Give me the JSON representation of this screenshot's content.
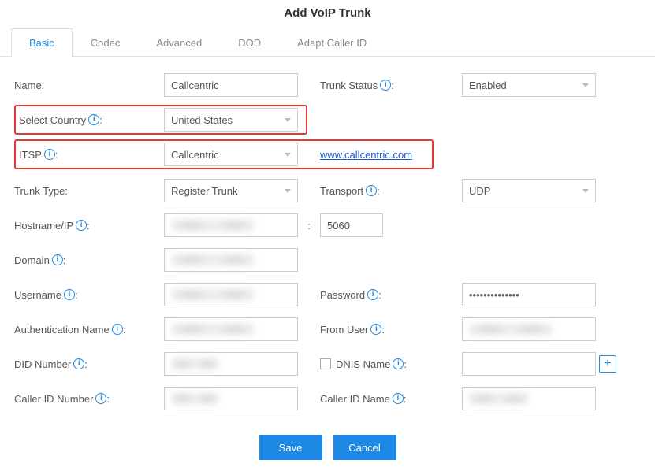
{
  "title": "Add VoIP Trunk",
  "tabs": [
    "Basic",
    "Codec",
    "Advanced",
    "DOD",
    "Adapt Caller ID"
  ],
  "labels": {
    "name": "Name:",
    "trunk_status": "Trunk Status",
    "select_country": "Select Country",
    "itsp": "ITSP",
    "trunk_type": "Trunk Type:",
    "transport": "Transport",
    "hostname": "Hostname/IP",
    "domain": "Domain",
    "username": "Username",
    "password": "Password",
    "auth_name": "Authentication Name",
    "from_user": "From User",
    "did_number": "DID Number",
    "dnis_name": "DNIS Name",
    "caller_id_number": "Caller ID Number",
    "caller_id_name": "Caller ID Name"
  },
  "values": {
    "name": "Callcentric",
    "trunk_status": "Enabled",
    "select_country": "United States",
    "itsp": "Callcentric",
    "itsp_link": "www.callcentric.com",
    "trunk_type": "Register Trunk",
    "transport": "UDP",
    "port": "5060",
    "password": "••••••••••••••"
  },
  "buttons": {
    "save": "Save",
    "cancel": "Cancel"
  },
  "colon_after_info": ":"
}
